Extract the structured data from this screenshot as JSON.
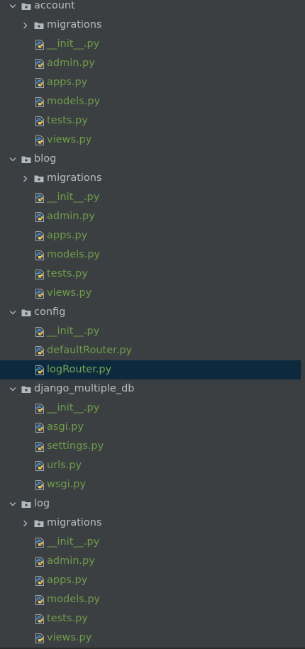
{
  "project_tree": {
    "items": [
      {
        "kind": "folder",
        "label": "account",
        "expanded": true,
        "depth": 0,
        "icon": "package-folder-icon"
      },
      {
        "kind": "folder",
        "label": "migrations",
        "expanded": false,
        "depth": 1,
        "icon": "package-folder-icon"
      },
      {
        "kind": "file",
        "label": "__init__.py",
        "depth": 1,
        "icon": "python-file-icon"
      },
      {
        "kind": "file",
        "label": "admin.py",
        "depth": 1,
        "icon": "python-file-icon"
      },
      {
        "kind": "file",
        "label": "apps.py",
        "depth": 1,
        "icon": "python-file-icon"
      },
      {
        "kind": "file",
        "label": "models.py",
        "depth": 1,
        "icon": "python-file-icon"
      },
      {
        "kind": "file",
        "label": "tests.py",
        "depth": 1,
        "icon": "python-file-icon"
      },
      {
        "kind": "file",
        "label": "views.py",
        "depth": 1,
        "icon": "python-file-icon"
      },
      {
        "kind": "folder",
        "label": "blog",
        "expanded": true,
        "depth": 0,
        "icon": "package-folder-icon"
      },
      {
        "kind": "folder",
        "label": "migrations",
        "expanded": false,
        "depth": 1,
        "icon": "package-folder-icon"
      },
      {
        "kind": "file",
        "label": "__init__.py",
        "depth": 1,
        "icon": "python-file-icon"
      },
      {
        "kind": "file",
        "label": "admin.py",
        "depth": 1,
        "icon": "python-file-icon"
      },
      {
        "kind": "file",
        "label": "apps.py",
        "depth": 1,
        "icon": "python-file-icon"
      },
      {
        "kind": "file",
        "label": "models.py",
        "depth": 1,
        "icon": "python-file-icon"
      },
      {
        "kind": "file",
        "label": "tests.py",
        "depth": 1,
        "icon": "python-file-icon"
      },
      {
        "kind": "file",
        "label": "views.py",
        "depth": 1,
        "icon": "python-file-icon"
      },
      {
        "kind": "folder",
        "label": "config",
        "expanded": true,
        "depth": 0,
        "icon": "package-folder-icon"
      },
      {
        "kind": "file",
        "label": "__init__.py",
        "depth": 1,
        "icon": "python-file-icon"
      },
      {
        "kind": "file",
        "label": "defaultRouter.py",
        "depth": 1,
        "icon": "python-file-icon"
      },
      {
        "kind": "file",
        "label": "logRouter.py",
        "depth": 1,
        "icon": "python-file-icon",
        "selected": true
      },
      {
        "kind": "folder",
        "label": "django_multiple_db",
        "expanded": true,
        "depth": 0,
        "icon": "package-folder-icon"
      },
      {
        "kind": "file",
        "label": "__init__.py",
        "depth": 1,
        "icon": "python-file-icon"
      },
      {
        "kind": "file",
        "label": "asgi.py",
        "depth": 1,
        "icon": "python-file-icon"
      },
      {
        "kind": "file",
        "label": "settings.py",
        "depth": 1,
        "icon": "python-file-icon"
      },
      {
        "kind": "file",
        "label": "urls.py",
        "depth": 1,
        "icon": "python-file-icon"
      },
      {
        "kind": "file",
        "label": "wsgi.py",
        "depth": 1,
        "icon": "python-file-icon"
      },
      {
        "kind": "folder",
        "label": "log",
        "expanded": true,
        "depth": 0,
        "icon": "package-folder-icon"
      },
      {
        "kind": "folder",
        "label": "migrations",
        "expanded": false,
        "depth": 1,
        "icon": "package-folder-icon"
      },
      {
        "kind": "file",
        "label": "__init__.py",
        "depth": 1,
        "icon": "python-file-icon"
      },
      {
        "kind": "file",
        "label": "admin.py",
        "depth": 1,
        "icon": "python-file-icon"
      },
      {
        "kind": "file",
        "label": "apps.py",
        "depth": 1,
        "icon": "python-file-icon"
      },
      {
        "kind": "file",
        "label": "models.py",
        "depth": 1,
        "icon": "python-file-icon"
      },
      {
        "kind": "file",
        "label": "tests.py",
        "depth": 1,
        "icon": "python-file-icon"
      },
      {
        "kind": "file",
        "label": "views.py",
        "depth": 1,
        "icon": "python-file-icon"
      }
    ]
  },
  "colors": {
    "background": "#3c3f41",
    "selection": "#0d293e",
    "folder_text": "#bbbbbb",
    "python_file_text": "#6e9e4a",
    "folder_icon": "#aeb9c0",
    "python_blue": "#4a88c7",
    "python_yellow": "#f4d35e"
  }
}
